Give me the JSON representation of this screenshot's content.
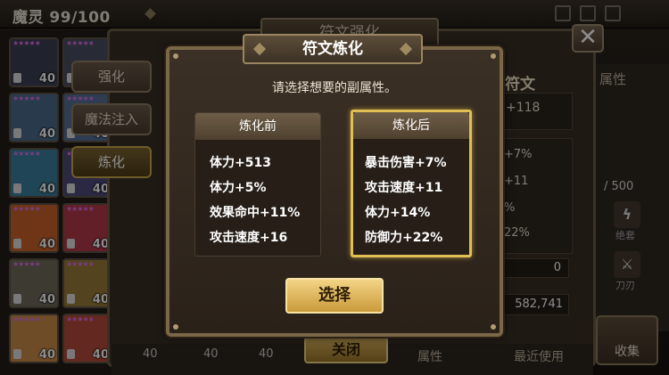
{
  "topbar": {
    "monster_count": "魔灵 99/100"
  },
  "grid": {
    "level_label": "40",
    "stars": "★★★★★"
  },
  "side_tabs": [
    "强化",
    "魔法注入",
    "炼化"
  ],
  "background": {
    "title": "符文强化",
    "rune_label": "符文",
    "main_stat": "+118",
    "stats": [
      "+7%",
      "+11",
      "%",
      "22%"
    ],
    "zero_value": "0",
    "gold_value": "582,741",
    "attr_label": "属性",
    "fraction": "/ 500",
    "icon1_label": "绝套",
    "icon2_label": "刀刃",
    "collect_label": "收集",
    "bottom_close": "关闭",
    "bottom_attr": "属性",
    "bottom_recent": "最近使用",
    "bottom_levels": [
      "40",
      "40",
      "40"
    ]
  },
  "modal": {
    "title": "符文炼化",
    "prompt": "请选择想要的副属性。",
    "before": {
      "header": "炼化前",
      "lines": [
        "体力+513",
        "体力+5%",
        "效果命中+11%",
        "攻击速度+16"
      ]
    },
    "after": {
      "header": "炼化后",
      "lines": [
        "暴击伤害+7%",
        "攻击速度+11",
        "体力+14%",
        "防御力+22%"
      ]
    },
    "select_label": "选择"
  }
}
